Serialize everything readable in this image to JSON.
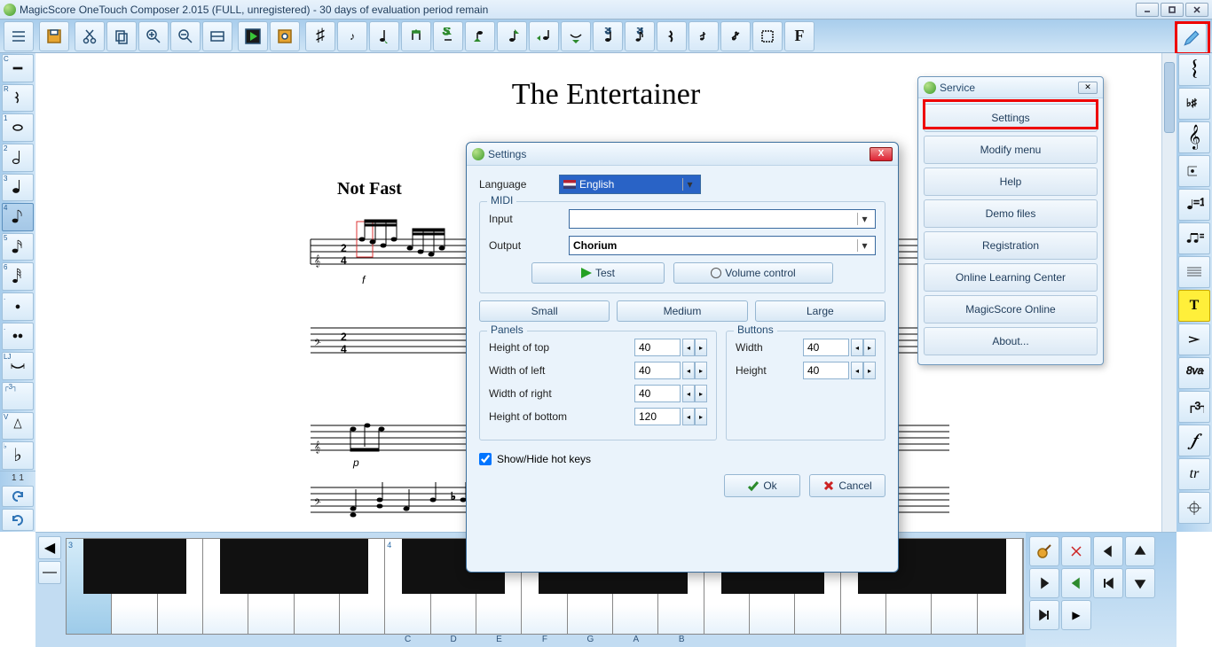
{
  "titlebar": {
    "text": "MagicScore OneTouch Composer 2.015 (FULL, unregistered) - 30 days of evaluation period remain"
  },
  "toolbar": {
    "items": [
      "menu",
      "save",
      "cut",
      "copy",
      "zoom-in",
      "zoom-out",
      "fit",
      "play",
      "options",
      "sharp",
      "eighth-up",
      "eighth-down",
      "rest-flag",
      "rest-s",
      "q-down",
      "q-up",
      "h-down",
      "triplet-q",
      "triplet-e",
      "rest",
      "accent",
      "accent2",
      "select",
      "bold-f"
    ]
  },
  "score": {
    "title": "The Entertainer",
    "tempo": "Not Fast",
    "dynamic1": "f",
    "dynamic2": "p",
    "timesig": "2/4"
  },
  "left_palette_super": [
    "C",
    "R",
    "1",
    "2",
    "3",
    "4",
    "5",
    "6",
    ".",
    ".",
    "LJ",
    "┌3┐",
    "V",
    "♭"
  ],
  "left_palette_active_index": 4,
  "left_counter": "1 1",
  "right_palette": [
    "brace",
    "key-sig",
    "treble",
    "accent",
    "tempo-120",
    "tempo-eighth",
    "staff-lines",
    "text",
    "sforz",
    "8va",
    "r3",
    "f-italic",
    "trill",
    "target"
  ],
  "service": {
    "title": "Service",
    "items": [
      "Settings",
      "Modify menu",
      "Help",
      "Demo files",
      "Registration",
      "Online Learning Center",
      "MagicScore Online",
      "About..."
    ]
  },
  "settings": {
    "title": "Settings",
    "language_label": "Language",
    "language_value": "English",
    "midi_label": "MIDI",
    "input_label": "Input",
    "input_value": "",
    "output_label": "Output",
    "output_value": "Chorium",
    "test_btn": "Test",
    "volctl_btn": "Volume control",
    "sizes": {
      "small": "Small",
      "medium": "Medium",
      "large": "Large"
    },
    "panels": {
      "title": "Panels",
      "rows": [
        {
          "label": "Height of top",
          "value": "40"
        },
        {
          "label": "Width of left",
          "value": "40"
        },
        {
          "label": "Width of right",
          "value": "40"
        },
        {
          "label": "Height of bottom",
          "value": "120"
        }
      ]
    },
    "buttons": {
      "title": "Buttons",
      "rows": [
        {
          "label": "Width",
          "value": "40"
        },
        {
          "label": "Height",
          "value": "40"
        }
      ]
    },
    "hotkeys_label": "Show/Hide hot keys",
    "hotkeys_checked": true,
    "ok": "Ok",
    "cancel": "Cancel"
  },
  "piano": {
    "octave_labels": [
      "3",
      "4"
    ],
    "note_names": [
      "C",
      "D",
      "E",
      "F",
      "G",
      "A",
      "B"
    ],
    "pressed_white_index": 0
  }
}
